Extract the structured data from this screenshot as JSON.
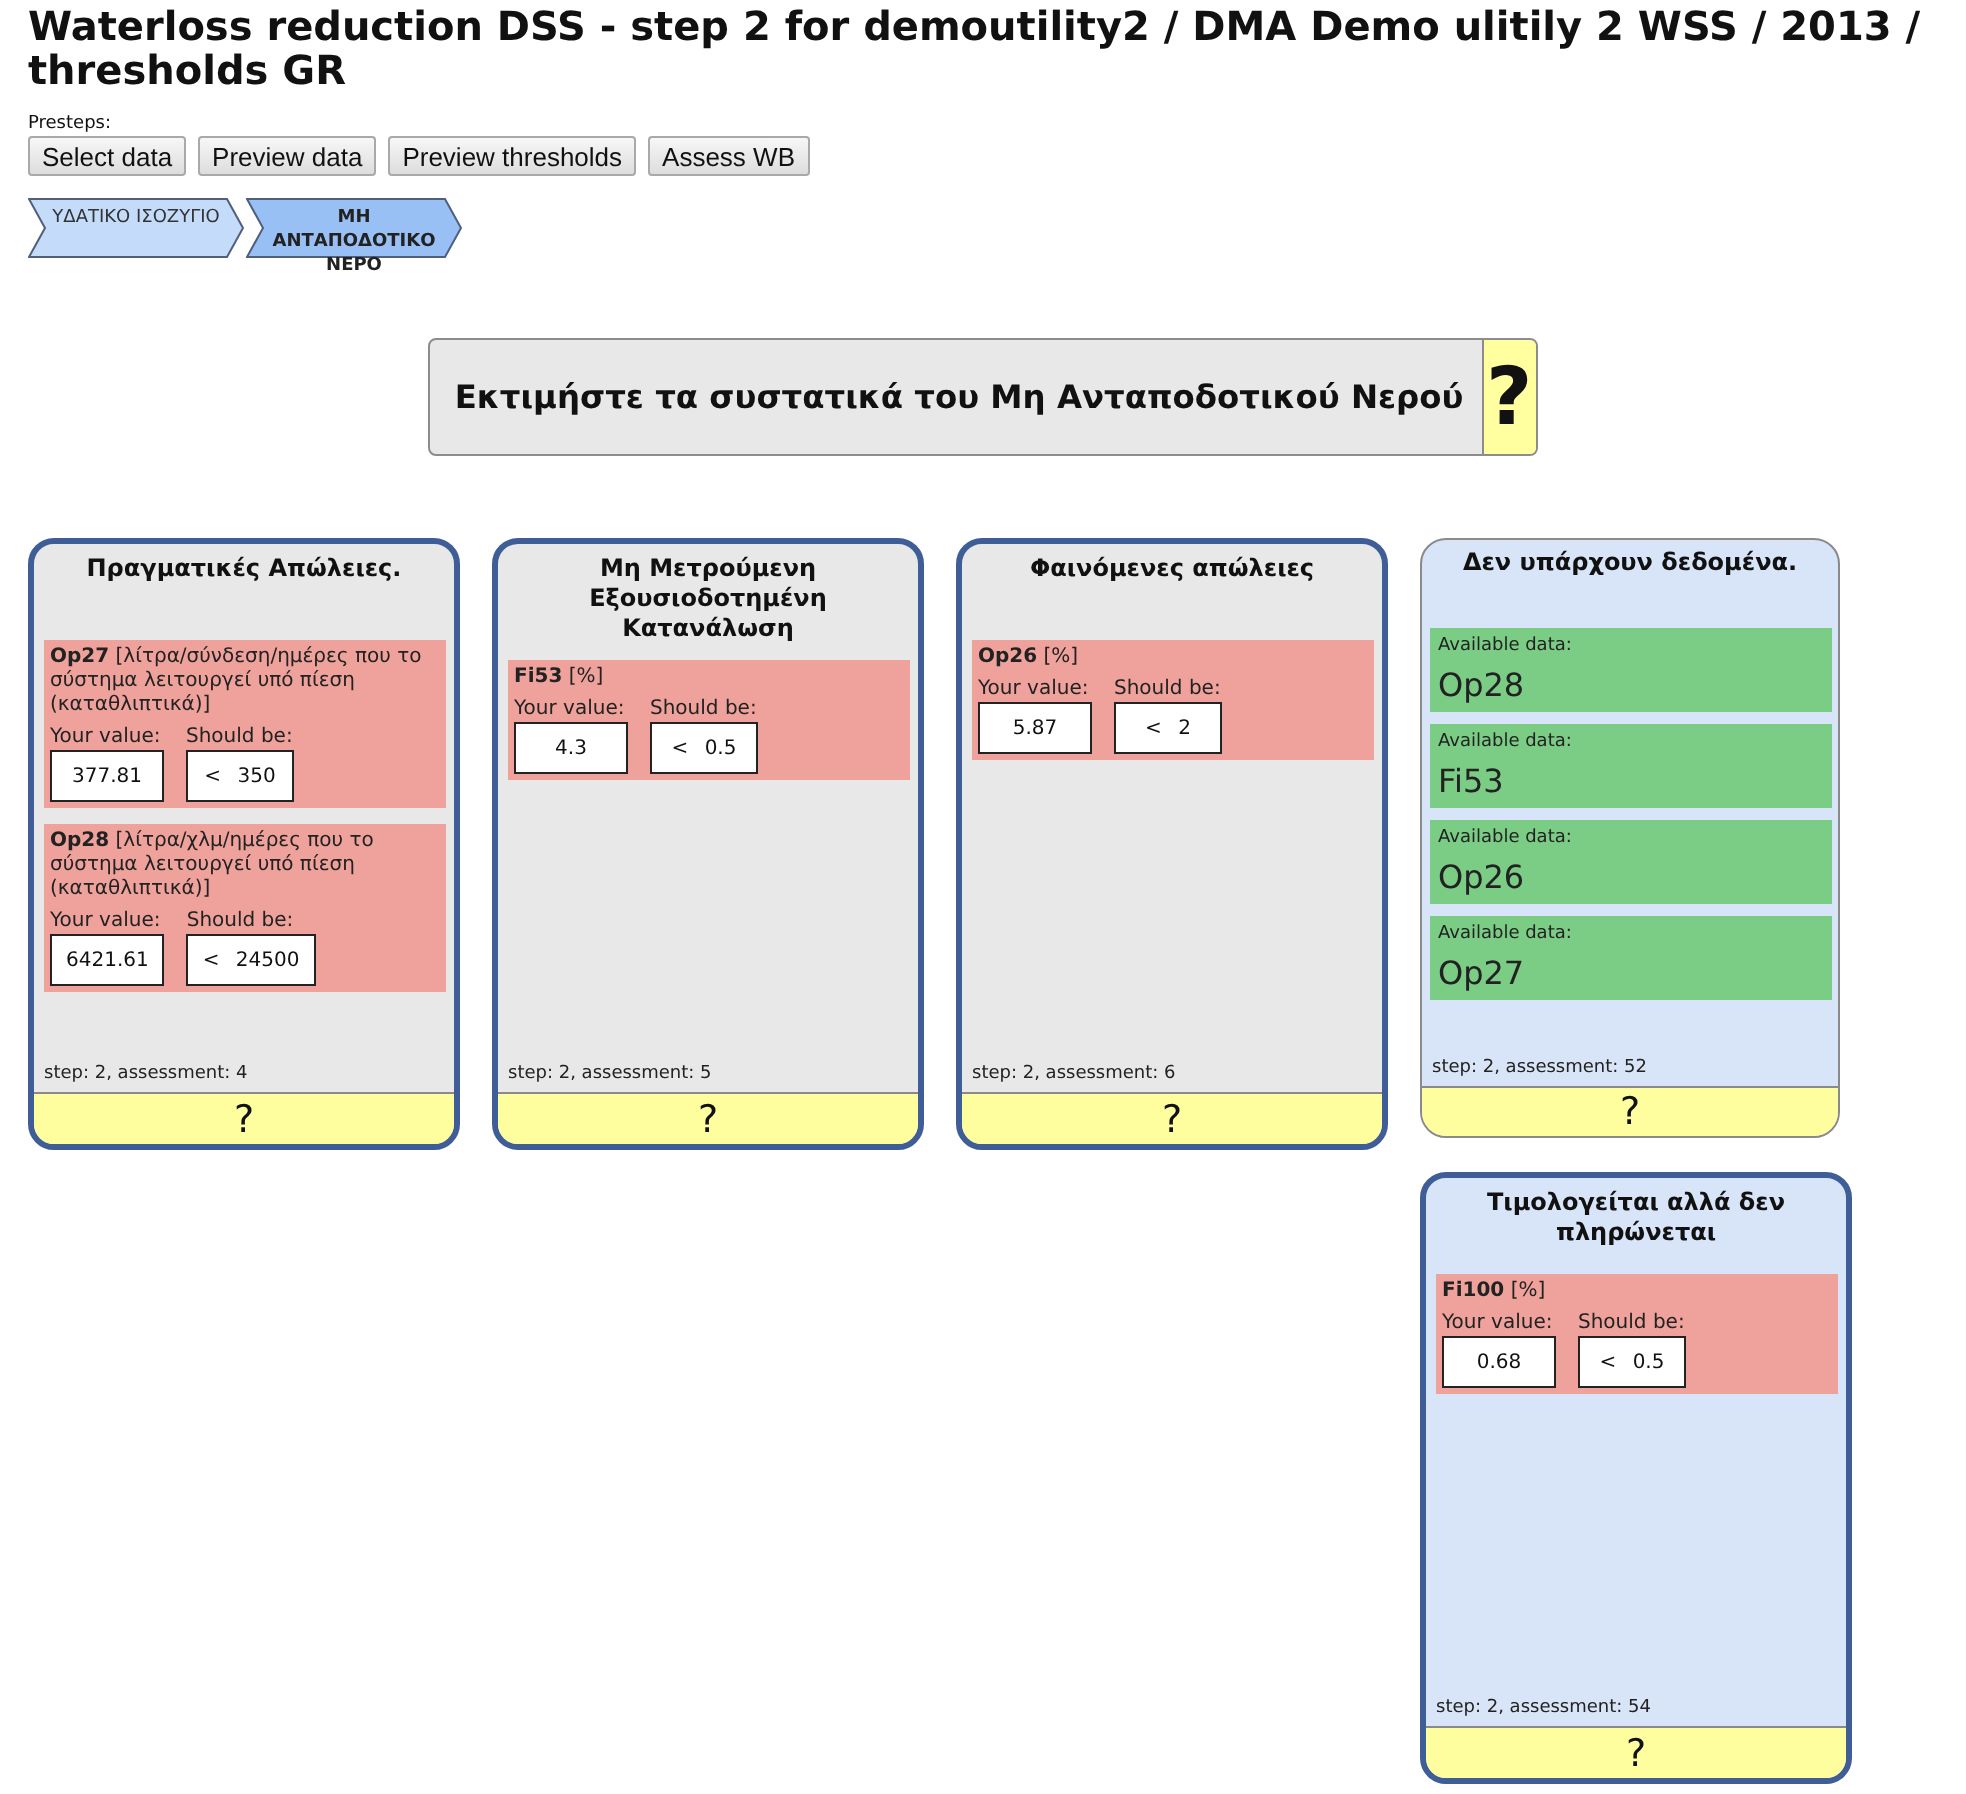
{
  "page_title": "Waterloss reduction DSS - step 2 for demoutility2 / DMA Demo ulitily 2 WSS / 2013 / thresholds GR",
  "presteps": {
    "label": "Presteps:",
    "buttons": [
      "Select data",
      "Preview data",
      "Preview thresholds",
      "Assess WB"
    ]
  },
  "steps": [
    {
      "label": "ΥΔΑΤΙΚΟ ΙΣΟΖΥΓΙΟ",
      "selected": false
    },
    {
      "label": "ΜΗ ΑΝΤΑΠΟΔΟΤΙΚΟ ΝΕΡΟ",
      "selected": true
    }
  ],
  "heading": {
    "text": "Εκτιμήστε τα συστατικά του Μη Ανταποδοτικού Νερού",
    "help": "?"
  },
  "columns": [
    {
      "cards": [
        {
          "kind": "assessment",
          "color": "#e8e8e8",
          "title": "Πραγματικές Απώλειες.",
          "indicators": [
            {
              "name": "**Op27** [λίτρα/σύνδεση/ημέρες που το σύστημα λειτουργεί υπό πίεση (καταθλιπτικά)]",
              "value_label": "Your value:",
              "value": "377.81",
              "threshold_label": "Should be:",
              "threshold": "< 350"
            },
            {
              "name": "**Op28** [λίτρα/χλμ/ημέρες που το σύστημα λειτουργεί υπό πίεση (καταθλιπτικά)]",
              "value_label": "Your value:",
              "value": "6421.61",
              "threshold_label": "Should be:",
              "threshold": "< 24500"
            }
          ],
          "footer": "step: 2, assessment: 4",
          "help": "?"
        }
      ]
    },
    {
      "cards": [
        {
          "kind": "assessment",
          "color": "#e8e8e8",
          "title": "Μη Μετρούμενη Εξουσιοδοτημένη Κατανάλωση",
          "indicators": [
            {
              "name": "**Fi53** [%]",
              "value_label": "Your value:",
              "value": "4.3",
              "threshold_label": "Should be:",
              "threshold": "< 0.5"
            }
          ],
          "footer": "step: 2, assessment: 5",
          "help": "?"
        }
      ]
    },
    {
      "cards": [
        {
          "kind": "assessment",
          "color": "#e8e8e8",
          "title": "Φαινόμενες απώλειες",
          "indicators": [
            {
              "name": "**Op26** [%]",
              "value_label": "Your value:",
              "value": "5.87",
              "threshold_label": "Should be:",
              "threshold": "< 2"
            }
          ],
          "footer": "step: 2, assessment: 6",
          "help": "?"
        }
      ]
    },
    {
      "cards": [
        {
          "kind": "available_data",
          "color": "#d8e4f7",
          "title": "Δεν υπάρχουν δεδομένα.",
          "items": [
            {
              "label": "Available data:",
              "code": "Op28"
            },
            {
              "label": "Available data:",
              "code": "Fi53"
            },
            {
              "label": "Available data:",
              "code": "Op26"
            },
            {
              "label": "Available data:",
              "code": "Op27"
            }
          ],
          "footer": "step: 2, assessment: 52",
          "help": "?"
        },
        {
          "kind": "assessment",
          "color": "#d8e4f7",
          "title": "Τιμολογείται αλλά δεν πληρώνεται",
          "indicators": [
            {
              "name": "**Fi100** [%]",
              "value_label": "Your value:",
              "value": "0.68",
              "threshold_label": "Should be:",
              "threshold": "< 0.5"
            }
          ],
          "footer": "step: 2, assessment: 54",
          "help": "?"
        }
      ]
    }
  ]
}
